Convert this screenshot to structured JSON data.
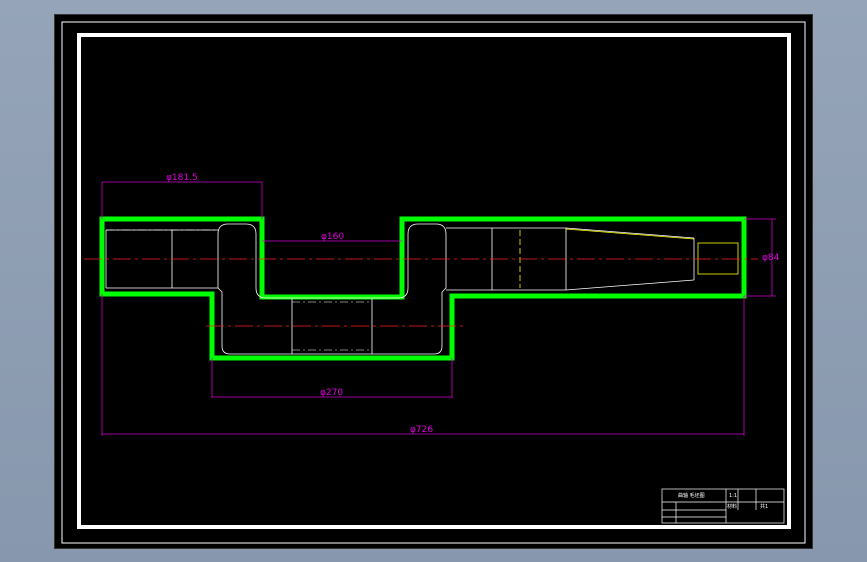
{
  "drawing": {
    "dimensions": {
      "d1": "φ181.5",
      "d2": "φ160",
      "d3": "φ84",
      "d4": "φ270",
      "d5": "φ726"
    },
    "title_block": {
      "name": "曲轴 毛坯图",
      "cell_a": "1:1",
      "cell_b": "材料",
      "cell_c": "共1"
    }
  }
}
